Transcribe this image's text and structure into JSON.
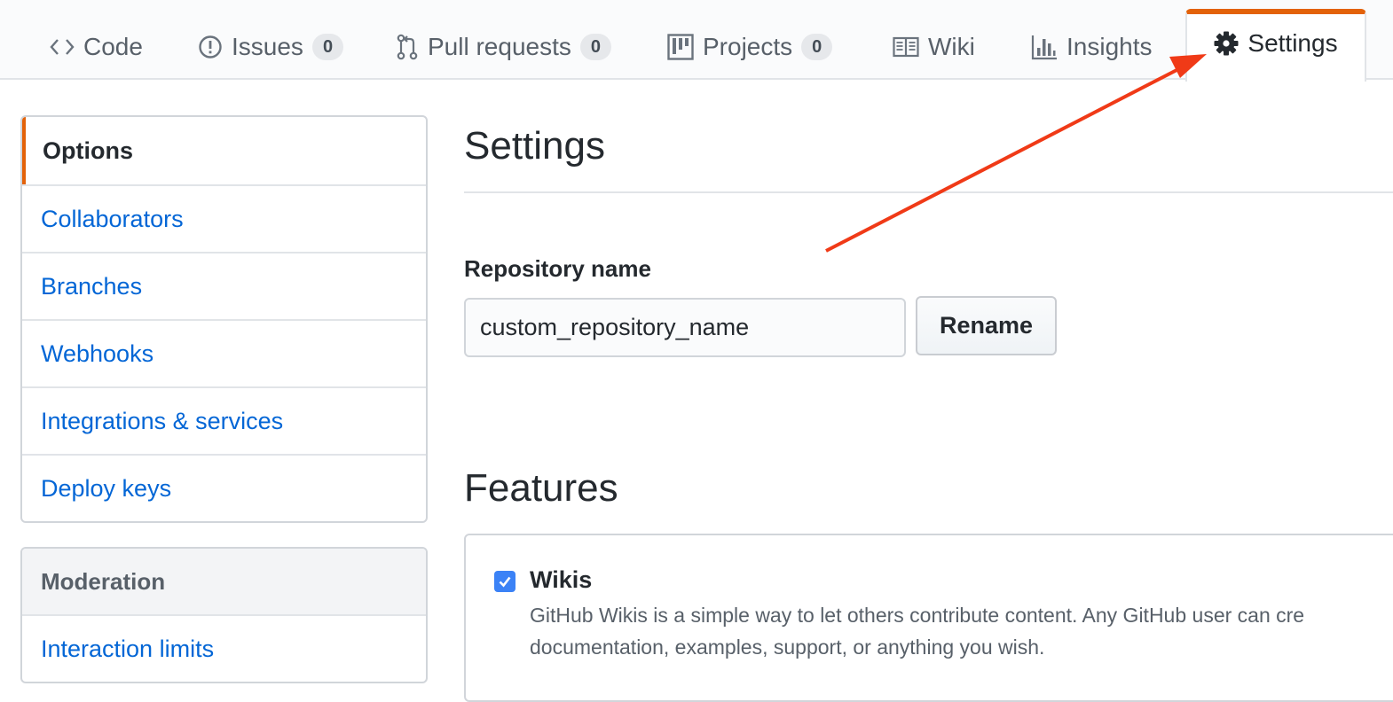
{
  "tabs": [
    {
      "label": "Code",
      "icon": "code-icon"
    },
    {
      "label": "Issues",
      "icon": "issue-icon",
      "count": "0"
    },
    {
      "label": "Pull requests",
      "icon": "pull-request-icon",
      "count": "0"
    },
    {
      "label": "Projects",
      "icon": "project-icon",
      "count": "0"
    },
    {
      "label": "Wiki",
      "icon": "book-icon"
    },
    {
      "label": "Insights",
      "icon": "graph-icon"
    },
    {
      "label": "Settings",
      "icon": "gear-icon",
      "selected": true
    }
  ],
  "sidebar": {
    "items": [
      {
        "label": "Options",
        "selected": true
      },
      {
        "label": "Collaborators"
      },
      {
        "label": "Branches"
      },
      {
        "label": "Webhooks"
      },
      {
        "label": "Integrations & services"
      },
      {
        "label": "Deploy keys"
      }
    ],
    "moderation": {
      "heading": "Moderation",
      "items": [
        {
          "label": "Interaction limits"
        }
      ]
    }
  },
  "main": {
    "title": "Settings",
    "repo_name_label": "Repository name",
    "repo_name_value": "custom_repository_name",
    "rename_label": "Rename",
    "features_title": "Features",
    "features": [
      {
        "name": "Wikis",
        "checked": true,
        "description_line1": "GitHub Wikis is a simple way to let others contribute content. Any GitHub user can cre",
        "description_line2": "documentation, examples, support, or anything you wish."
      }
    ]
  },
  "colors": {
    "accent_orange": "#e36209",
    "link_blue": "#0366d6",
    "annotation_arrow": "#f03a17",
    "checkbox_blue": "#3b82f6"
  }
}
